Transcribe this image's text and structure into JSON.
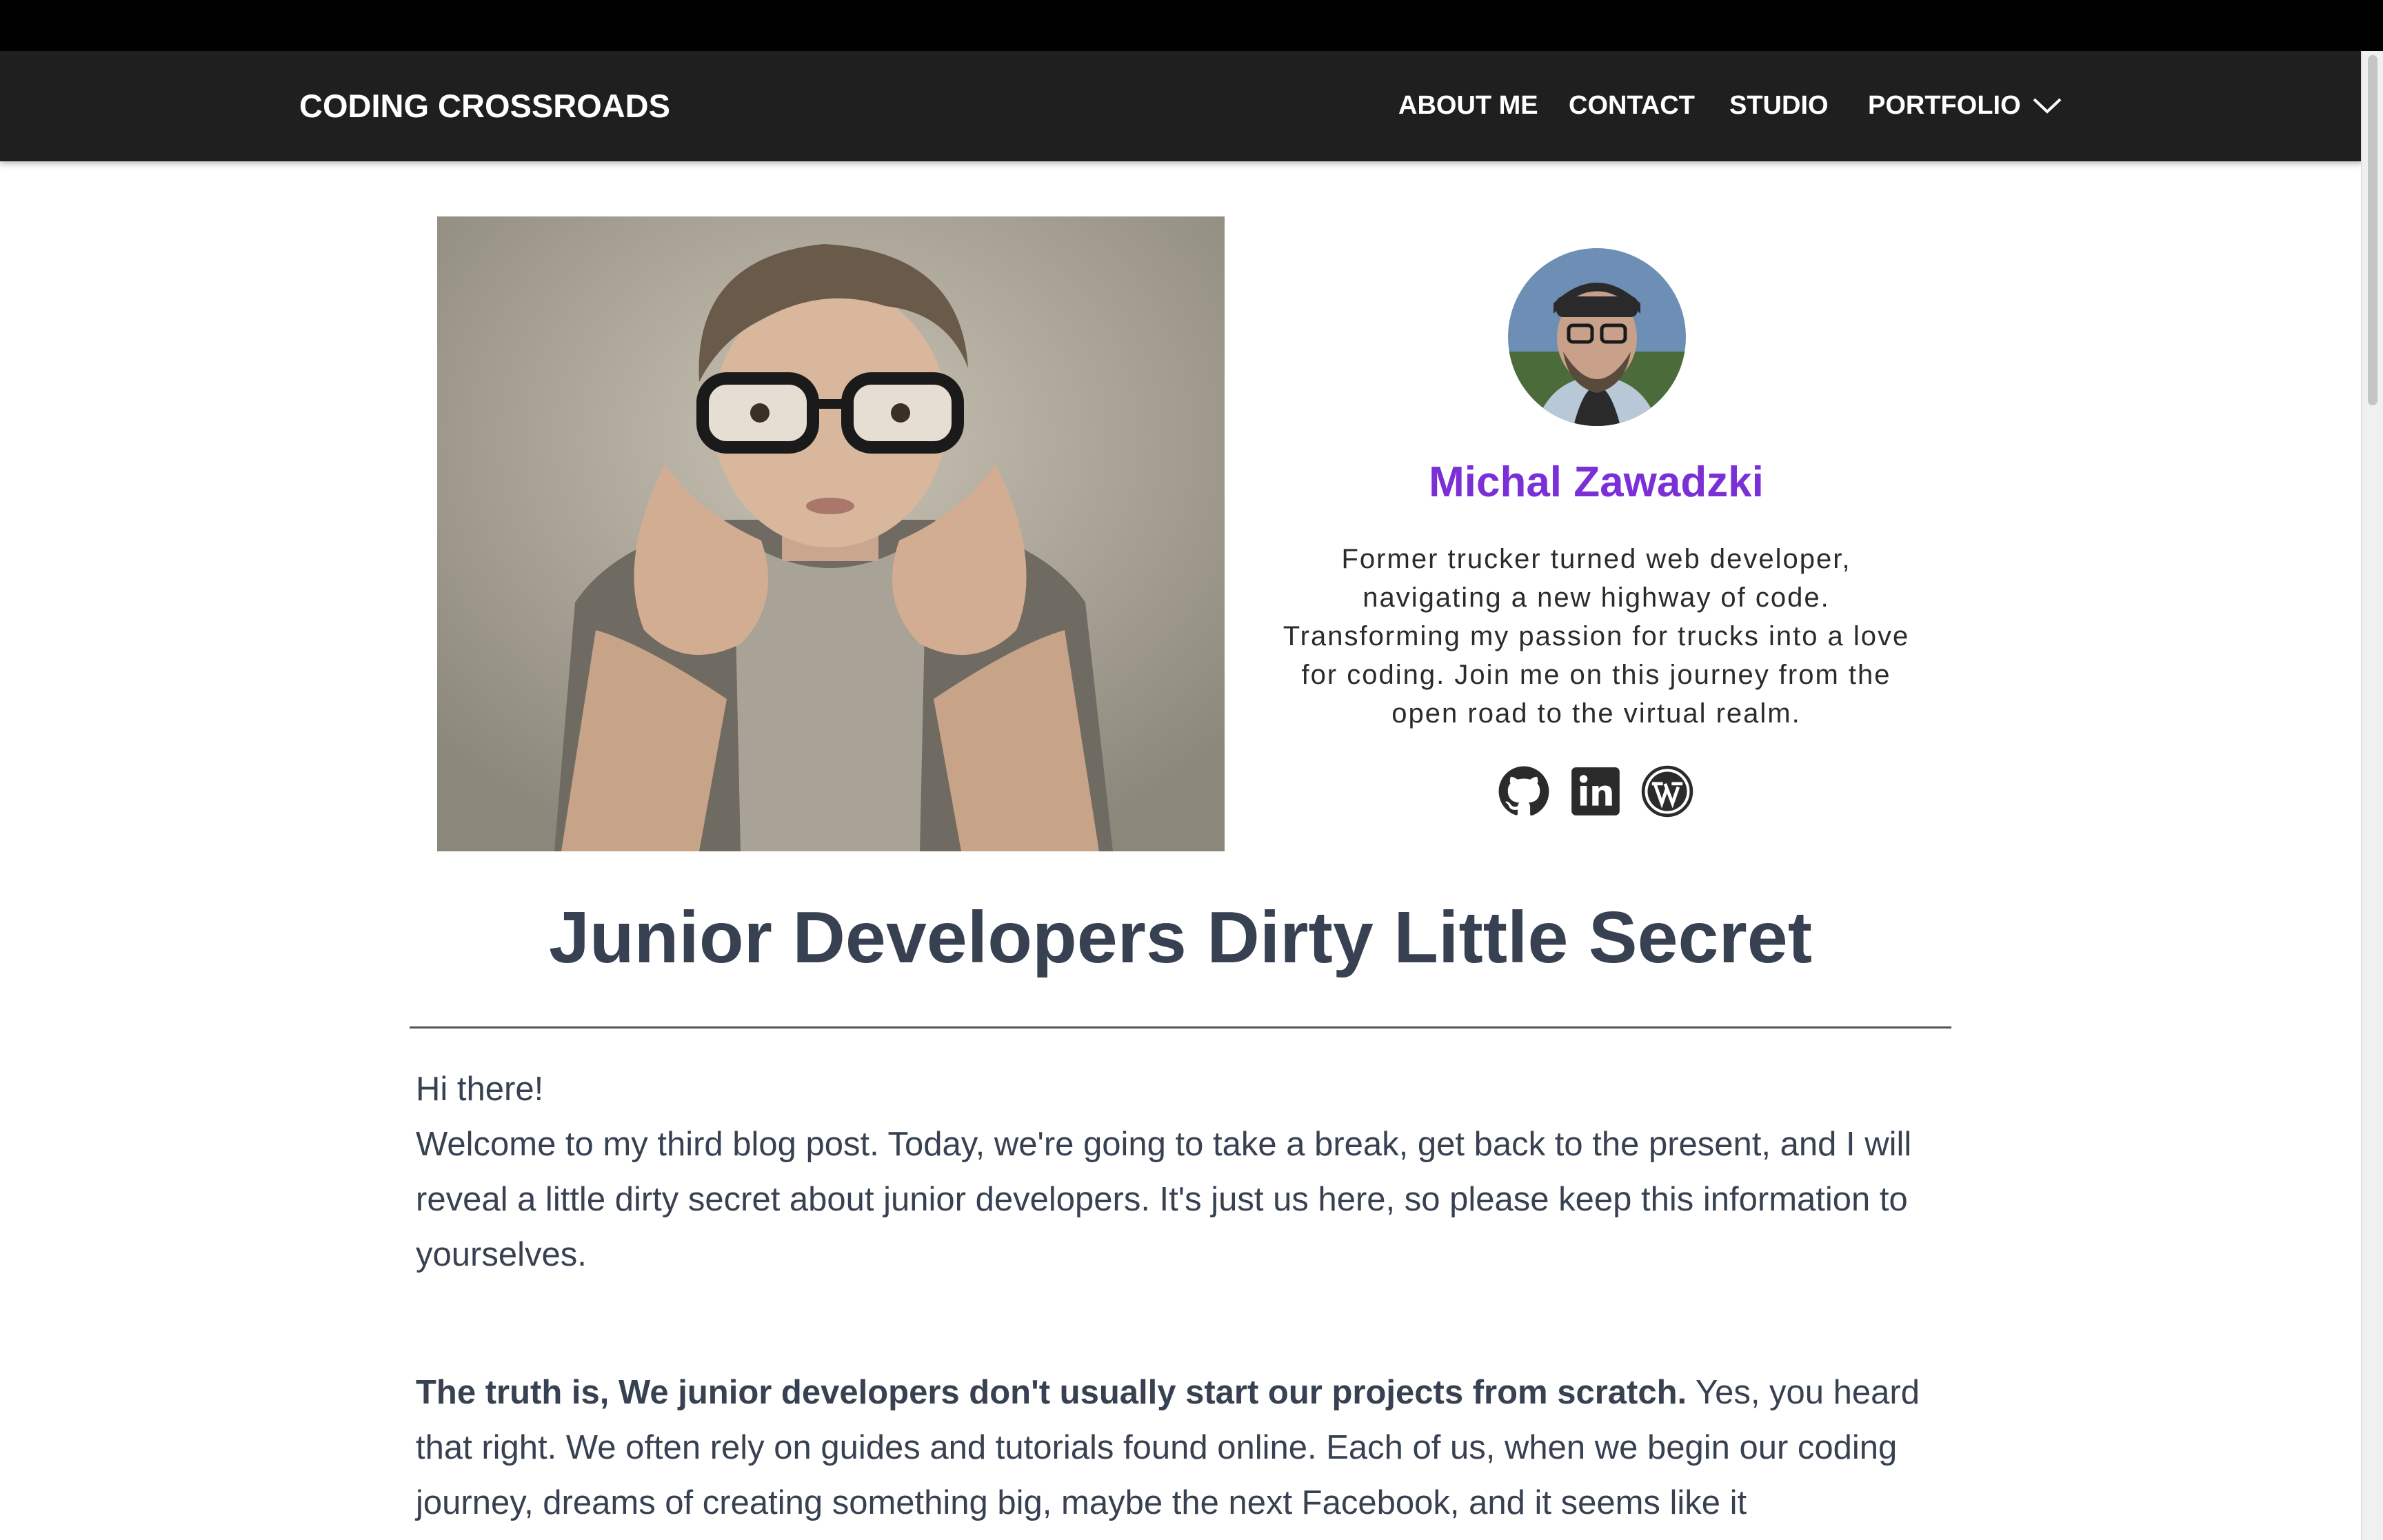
{
  "nav": {
    "brand": "CODING CROSSROADS",
    "links": [
      "ABOUT ME",
      "CONTACT",
      "STUDIO",
      "PORTFOLIO"
    ]
  },
  "icons": {
    "dropdown": "chevron-down-icon",
    "social": [
      "github-icon",
      "linkedin-icon",
      "wordpress-icon"
    ]
  },
  "author": {
    "name": "Michal Zawadzki",
    "bio": "Former trucker turned web developer, navigating a new highway of code. Transforming my passion for trucks into a love for coding. Join me on this journey from the open road to the virtual realm."
  },
  "post": {
    "title": "Junior Developers Dirty Little Secret",
    "greeting": "Hi there!",
    "intro": "Welcome to my third blog post. Today, we're going to take a break, get back to the present, and I will reveal a little dirty secret about junior developers. It's just us here, so please keep this information to yourselves.",
    "truth_bold": "The truth is, We junior developers don't usually start our projects from scratch.",
    "truth_rest": " Yes, you heard that right. We often rely on guides and tutorials found online. Each of us, when we begin our coding journey, dreams of creating something big, maybe the next Facebook, and it seems like it"
  },
  "colors": {
    "accent": "#7b2fd6",
    "navbar": "#1f1f1f",
    "text": "#374151"
  }
}
